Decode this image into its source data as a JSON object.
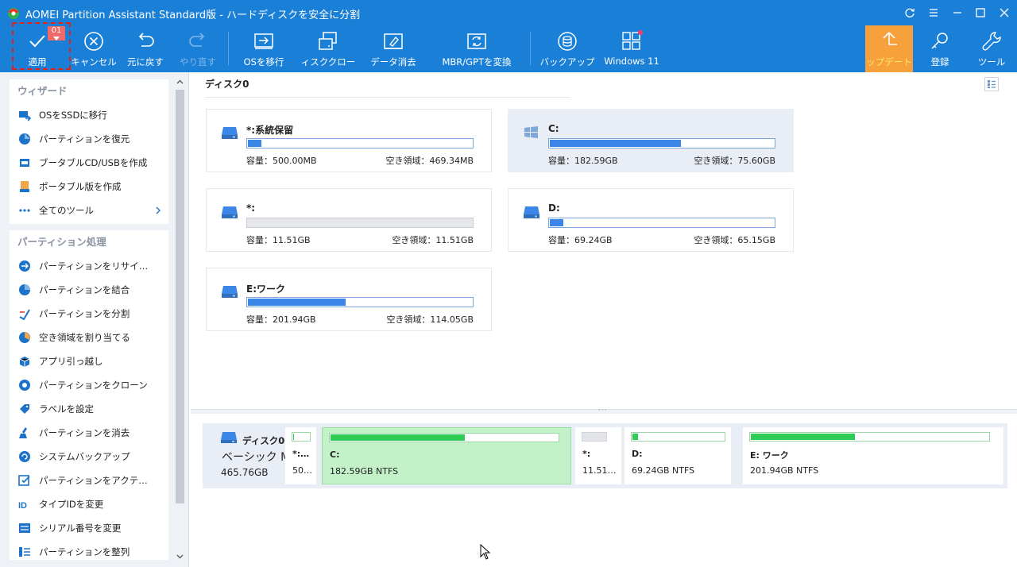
{
  "window": {
    "title": "AOMEI Partition Assistant Standard版 - ハードディスクを安全に分割"
  },
  "toolbar": {
    "apply_label": "適用",
    "apply_badge": "01",
    "cancel_label": "キャンセル",
    "undo_label": "元に戻す",
    "redo_label": "やり直す",
    "migrate_os_label": "OSを移行",
    "disk_clone_label": "ィスククロー",
    "data_wipe_label": "データ消去",
    "mbr_gpt_label": "MBR/GPTを変換",
    "backup_label": "バックアップ",
    "windows11_label": "Windows 11",
    "upgrade_label": "ップデート",
    "register_label": "登録",
    "tools_label": "ツール"
  },
  "sidebar": {
    "wizard": {
      "header": "ウィザード",
      "items": [
        {
          "label": "OSをSSDに移行",
          "icon": "migrate-icon"
        },
        {
          "label": "パーティションを復元",
          "icon": "restore-icon"
        },
        {
          "label": "ブータブルCD/USBを作成",
          "icon": "bootable-media-icon"
        },
        {
          "label": "ポータブル版を作成",
          "icon": "portable-icon"
        },
        {
          "label": "全てのツール",
          "icon": "dots-icon"
        }
      ]
    },
    "partition_ops": {
      "header": "パーティション処理",
      "items": [
        {
          "label": "パーティションをリサイ…",
          "icon": "resize-icon"
        },
        {
          "label": "パーティションを結合",
          "icon": "merge-icon"
        },
        {
          "label": "パーティションを分割",
          "icon": "split-icon"
        },
        {
          "label": "空き領域を割り当てる",
          "icon": "allocate-icon"
        },
        {
          "label": "アプリ引っ越し",
          "icon": "app-mover-icon"
        },
        {
          "label": "パーティションをクローン",
          "icon": "clone-icon"
        },
        {
          "label": "ラベルを設定",
          "icon": "label-icon"
        },
        {
          "label": "パーティションを消去",
          "icon": "wipe-icon"
        },
        {
          "label": "システムバックアップ",
          "icon": "system-backup-icon"
        },
        {
          "label": "パーティションをアクテ…",
          "icon": "activate-icon"
        },
        {
          "label": "タイプIDを変更",
          "icon": "type-id-icon"
        },
        {
          "label": "シリアル番号を変更",
          "icon": "serial-icon"
        },
        {
          "label": "パーティションを整列",
          "icon": "align-icon"
        }
      ]
    }
  },
  "main": {
    "disk_title": "ディスク0",
    "partitions": [
      {
        "name": "*:系統保留",
        "used_fraction": 0.06,
        "capacity": "容量：500.00MB",
        "free": "空き領域：469.34MB",
        "icon": "drive-icon",
        "selected": false
      },
      {
        "name": "C:",
        "used_fraction": 0.586,
        "capacity": "容量：182.59GB",
        "free": "空き領域：75.60GB",
        "icon": "windows-icon",
        "selected": true
      },
      {
        "name": "*:",
        "used_fraction": 0.0,
        "capacity": "容量：11.51GB",
        "free": "空き領域：11.51GB",
        "icon": "drive-icon",
        "selected": false
      },
      {
        "name": "D:",
        "used_fraction": 0.059,
        "capacity": "容量：69.24GB",
        "free": "空き領域：65.15GB",
        "icon": "drive-icon",
        "selected": false
      },
      {
        "name": "E:ワーク",
        "used_fraction": 0.435,
        "capacity": "容量：201.94GB",
        "free": "空き領域：114.05GB",
        "icon": "drive-icon",
        "selected": false
      }
    ],
    "disk_map": {
      "name": "ディスク0",
      "type": "ベーシック MBR",
      "size": "465.76GB",
      "blocks": [
        {
          "name": "*:…",
          "info": "50…",
          "used_fraction": 0.06
        },
        {
          "name": "C:",
          "info": "182.59GB NTFS",
          "used_fraction": 0.586
        },
        {
          "name": "*:",
          "info": "11.51…",
          "used_fraction": 0.0
        },
        {
          "name": "D:",
          "info": "69.24GB NTFS",
          "used_fraction": 0.059
        },
        {
          "name": "E: ワーク",
          "info": "201.94GB NTFS",
          "used_fraction": 0.435
        }
      ]
    }
  },
  "colors": {
    "title_bar": "#1a7fd6",
    "upgrade": "#f7a13d",
    "usage_bar": "#3b86e6",
    "map_usage": "#2ecc57"
  }
}
